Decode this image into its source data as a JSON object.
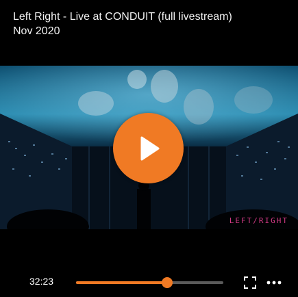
{
  "header": {
    "title": "Left Right - Live at CONDUIT (full livestream)",
    "date": "Nov 2020"
  },
  "video": {
    "watermark": "LEFT/RIGHT",
    "play_icon": "play-icon"
  },
  "controls": {
    "current_time": "32:23",
    "progress": 0.62,
    "fullscreen_icon": "fullscreen-icon",
    "more_icon": "more-options-icon"
  },
  "colors": {
    "accent": "#f07a24",
    "background": "#000000",
    "track": "#5a5a5a",
    "watermark": "#d23b86"
  }
}
